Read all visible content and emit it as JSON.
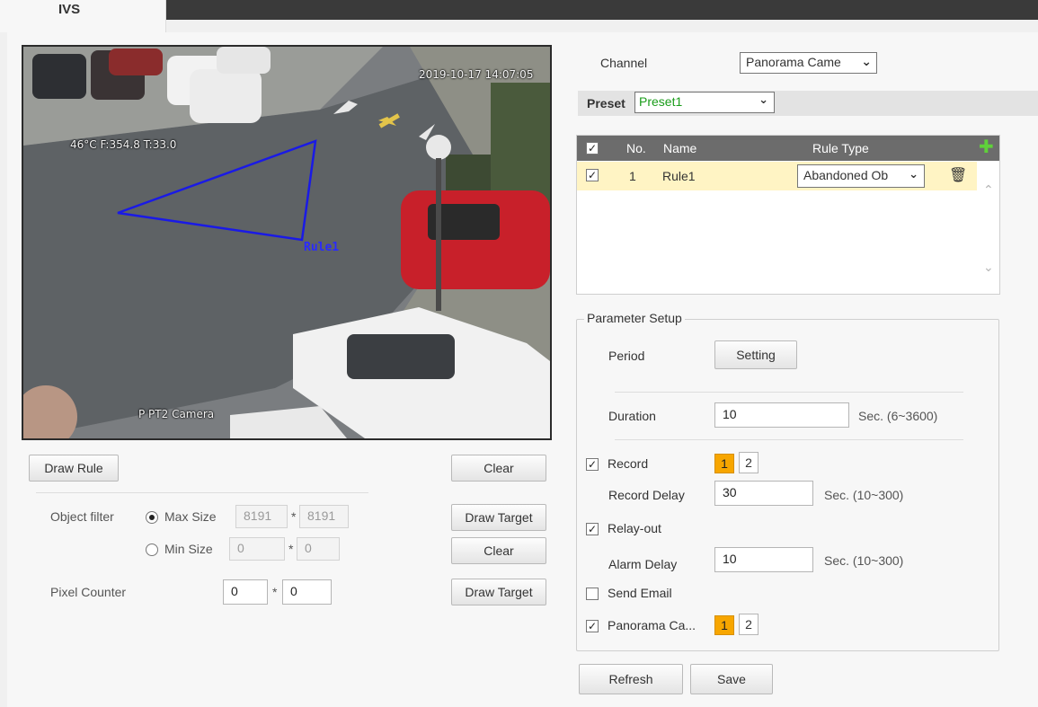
{
  "tab": {
    "label": "IVS"
  },
  "video": {
    "timestamp": "2019-10-17 14:07:05",
    "ptz_info": "46°C F:354.8 T:33.0",
    "camera_name": "P PT2 Camera",
    "rule_label": "Rule1",
    "rule_color": "#1a1ae6"
  },
  "left_controls": {
    "draw_rule": "Draw Rule",
    "clear_1": "Clear",
    "object_filter_label": "Object filter",
    "max_size_label": "Max Size",
    "max_w": "8191",
    "max_h": "8191",
    "min_size_label": "Min Size",
    "min_w": "0",
    "min_h": "0",
    "separator": "*",
    "draw_target_1": "Draw Target",
    "clear_2": "Clear",
    "draw_target_2": "Draw Target",
    "pixel_counter_label": "Pixel Counter",
    "pixel_w": "0",
    "pixel_h": "0"
  },
  "channel": {
    "label": "Channel",
    "value": "Panorama Came"
  },
  "preset": {
    "label": "Preset",
    "value": "Preset1",
    "value_color": "#1a9c1a"
  },
  "rules_table": {
    "headers": {
      "no": "No.",
      "name": "Name",
      "rule_type": "Rule Type"
    },
    "rows": [
      {
        "no": "1",
        "name": "Rule1",
        "rule_type": "Abandoned Ob"
      }
    ]
  },
  "parameter_setup": {
    "legend": "Parameter Setup",
    "period_label": "Period",
    "setting_button": "Setting",
    "duration_label": "Duration",
    "duration_value": "10",
    "duration_range": "Sec. (6~3600)",
    "record_label": "Record",
    "record_channels": [
      "1",
      "2"
    ],
    "record_delay_label": "Record Delay",
    "record_delay_value": "30",
    "record_delay_range": "Sec. (10~300)",
    "relay_out_label": "Relay-out",
    "alarm_delay_label": "Alarm Delay",
    "alarm_delay_value": "10",
    "alarm_delay_range": "Sec. (10~300)",
    "send_email_label": "Send Email",
    "panorama_label": "Panorama Ca...",
    "panorama_channels": [
      "1",
      "2"
    ]
  },
  "footer": {
    "refresh": "Refresh",
    "save": "Save"
  },
  "colors": {
    "accent_orange": "#f7a600",
    "header_gray": "#6c6c6c",
    "add_green": "#4caf2a"
  }
}
